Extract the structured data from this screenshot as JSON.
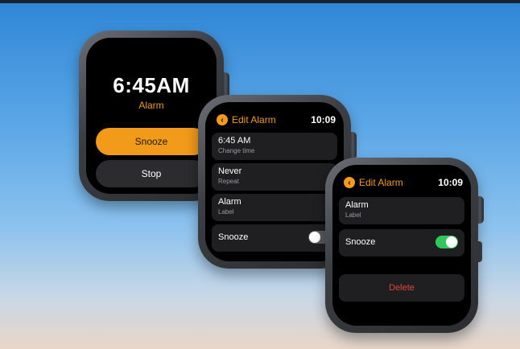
{
  "watch1": {
    "time": "6:45AM",
    "alarm_label": "Alarm",
    "snooze_button": "Snooze",
    "stop_button": "Stop",
    "accent_color": "#f29a1a"
  },
  "watch2": {
    "header_title": "Edit Alarm",
    "header_time": "10:09",
    "rows": [
      {
        "title": "6:45 AM",
        "subtitle": "Change time"
      },
      {
        "title": "Never",
        "subtitle": "Repeat"
      },
      {
        "title": "Alarm",
        "subtitle": "Label"
      }
    ],
    "snooze_label": "Snooze",
    "snooze_on": false
  },
  "watch3": {
    "header_title": "Edit Alarm",
    "header_time": "10:09",
    "rows": [
      {
        "title": "Alarm",
        "subtitle": "Label"
      }
    ],
    "snooze_label": "Snooze",
    "snooze_on": true,
    "delete_button": "Delete"
  }
}
